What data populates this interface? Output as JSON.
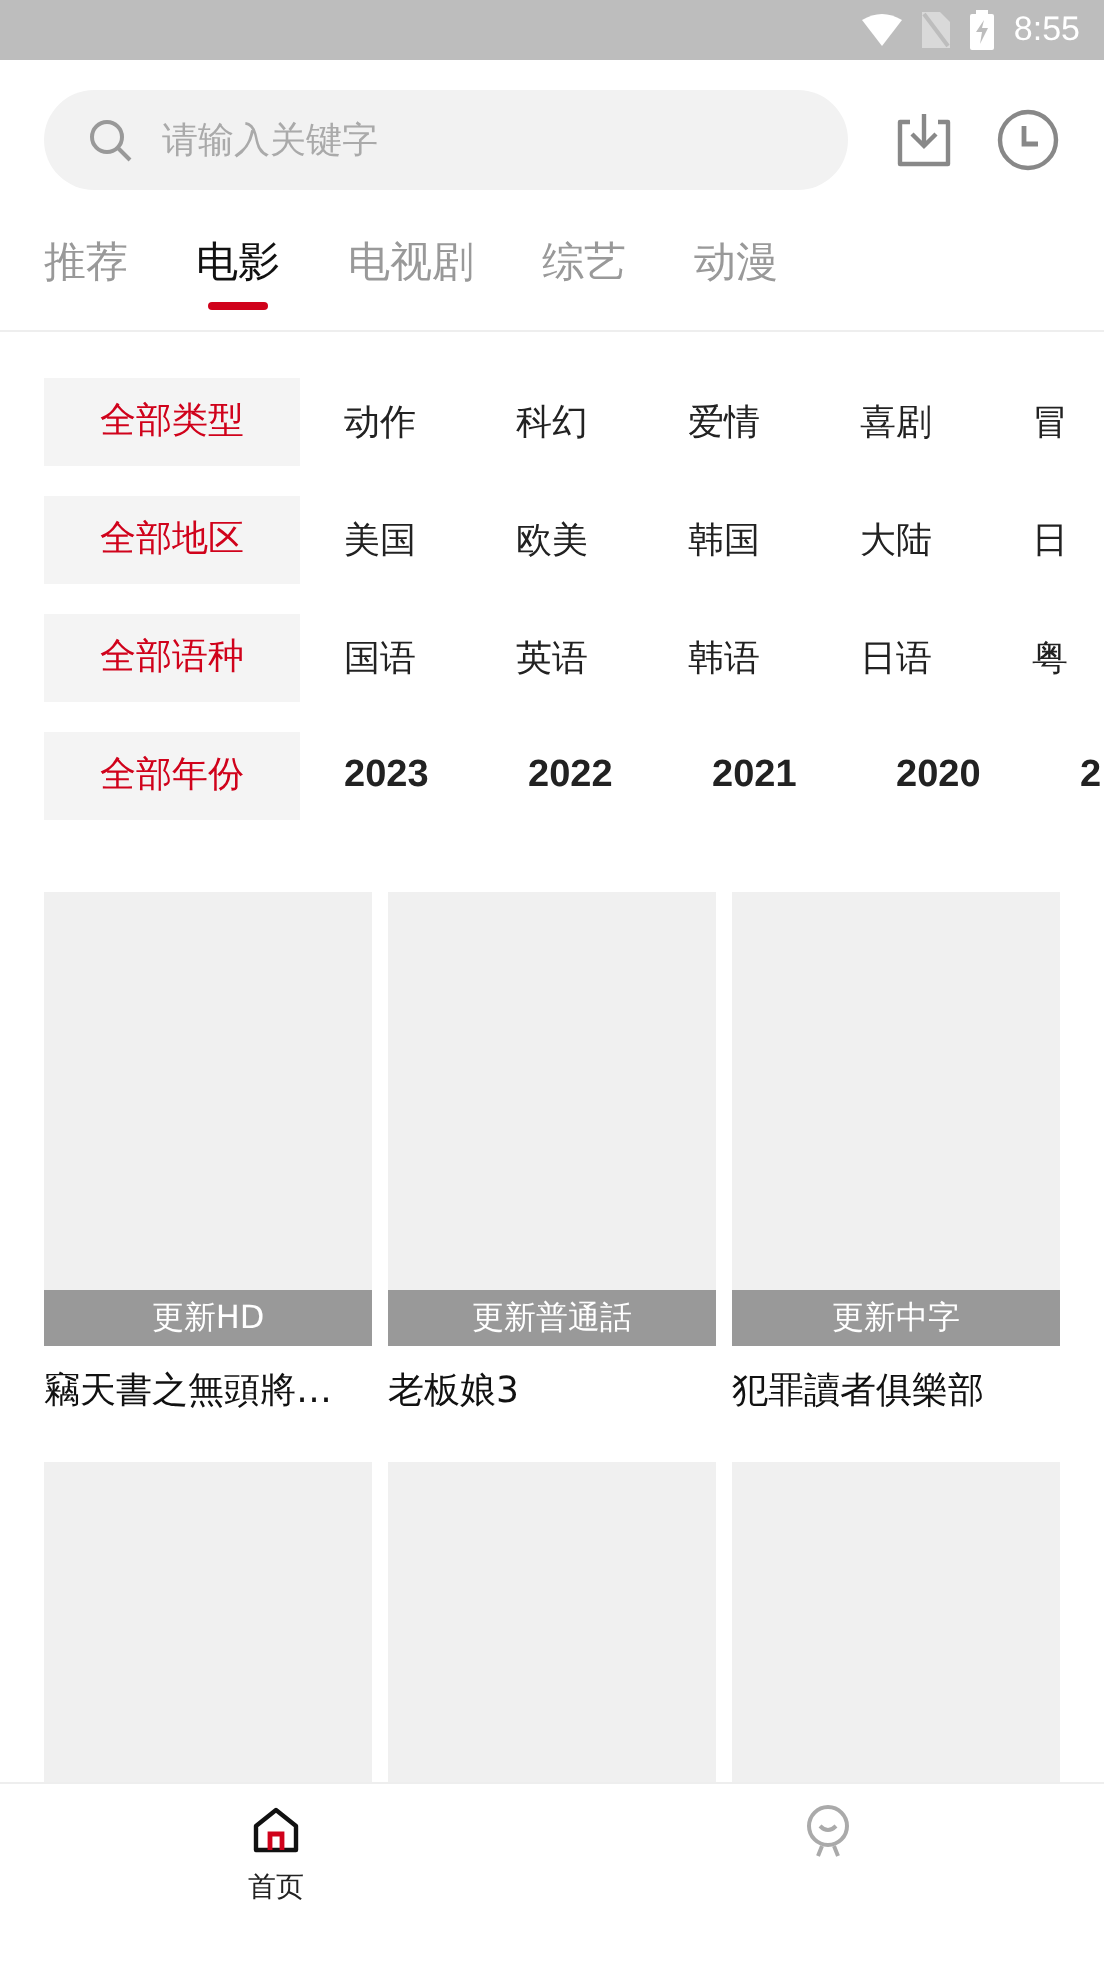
{
  "status_bar": {
    "time": "8:55"
  },
  "search": {
    "placeholder": "请输入关键字"
  },
  "tabs": [
    {
      "label": "推荐",
      "selected": false
    },
    {
      "label": "电影",
      "selected": true
    },
    {
      "label": "电视剧",
      "selected": false
    },
    {
      "label": "综艺",
      "selected": false
    },
    {
      "label": "动漫",
      "selected": false
    }
  ],
  "filters": [
    {
      "kind": "text",
      "options": [
        {
          "label": "全部类型",
          "selected": true
        },
        {
          "label": "动作",
          "selected": false
        },
        {
          "label": "科幻",
          "selected": false
        },
        {
          "label": "爱情",
          "selected": false
        },
        {
          "label": "喜剧",
          "selected": false
        },
        {
          "label": "冒",
          "selected": false
        }
      ]
    },
    {
      "kind": "text",
      "options": [
        {
          "label": "全部地区",
          "selected": true
        },
        {
          "label": "美国",
          "selected": false
        },
        {
          "label": "欧美",
          "selected": false
        },
        {
          "label": "韩国",
          "selected": false
        },
        {
          "label": "大陆",
          "selected": false
        },
        {
          "label": "日",
          "selected": false
        }
      ]
    },
    {
      "kind": "text",
      "options": [
        {
          "label": "全部语种",
          "selected": true
        },
        {
          "label": "国语",
          "selected": false
        },
        {
          "label": "英语",
          "selected": false
        },
        {
          "label": "韩语",
          "selected": false
        },
        {
          "label": "日语",
          "selected": false
        },
        {
          "label": "粤",
          "selected": false
        }
      ]
    },
    {
      "kind": "year",
      "options": [
        {
          "label": "全部年份",
          "selected": true
        },
        {
          "label": "2023",
          "selected": false
        },
        {
          "label": "2022",
          "selected": false
        },
        {
          "label": "2021",
          "selected": false
        },
        {
          "label": "2020",
          "selected": false
        },
        {
          "label": "2",
          "selected": false
        }
      ]
    }
  ],
  "movies": [
    {
      "kind": "captioned",
      "badge": "更新HD",
      "title": "竊天書之無頭將…"
    },
    {
      "kind": "captioned",
      "badge": "更新普通話",
      "title": "老板娘3"
    },
    {
      "kind": "captioned",
      "badge": "更新中字",
      "title": "犯罪讀者俱樂部"
    },
    {
      "kind": "blank"
    },
    {
      "kind": "blank"
    },
    {
      "kind": "blank"
    }
  ],
  "bottom_nav": [
    {
      "kind": "home",
      "label": "首页",
      "selected": true
    },
    {
      "kind": "smile",
      "selected": false
    }
  ]
}
